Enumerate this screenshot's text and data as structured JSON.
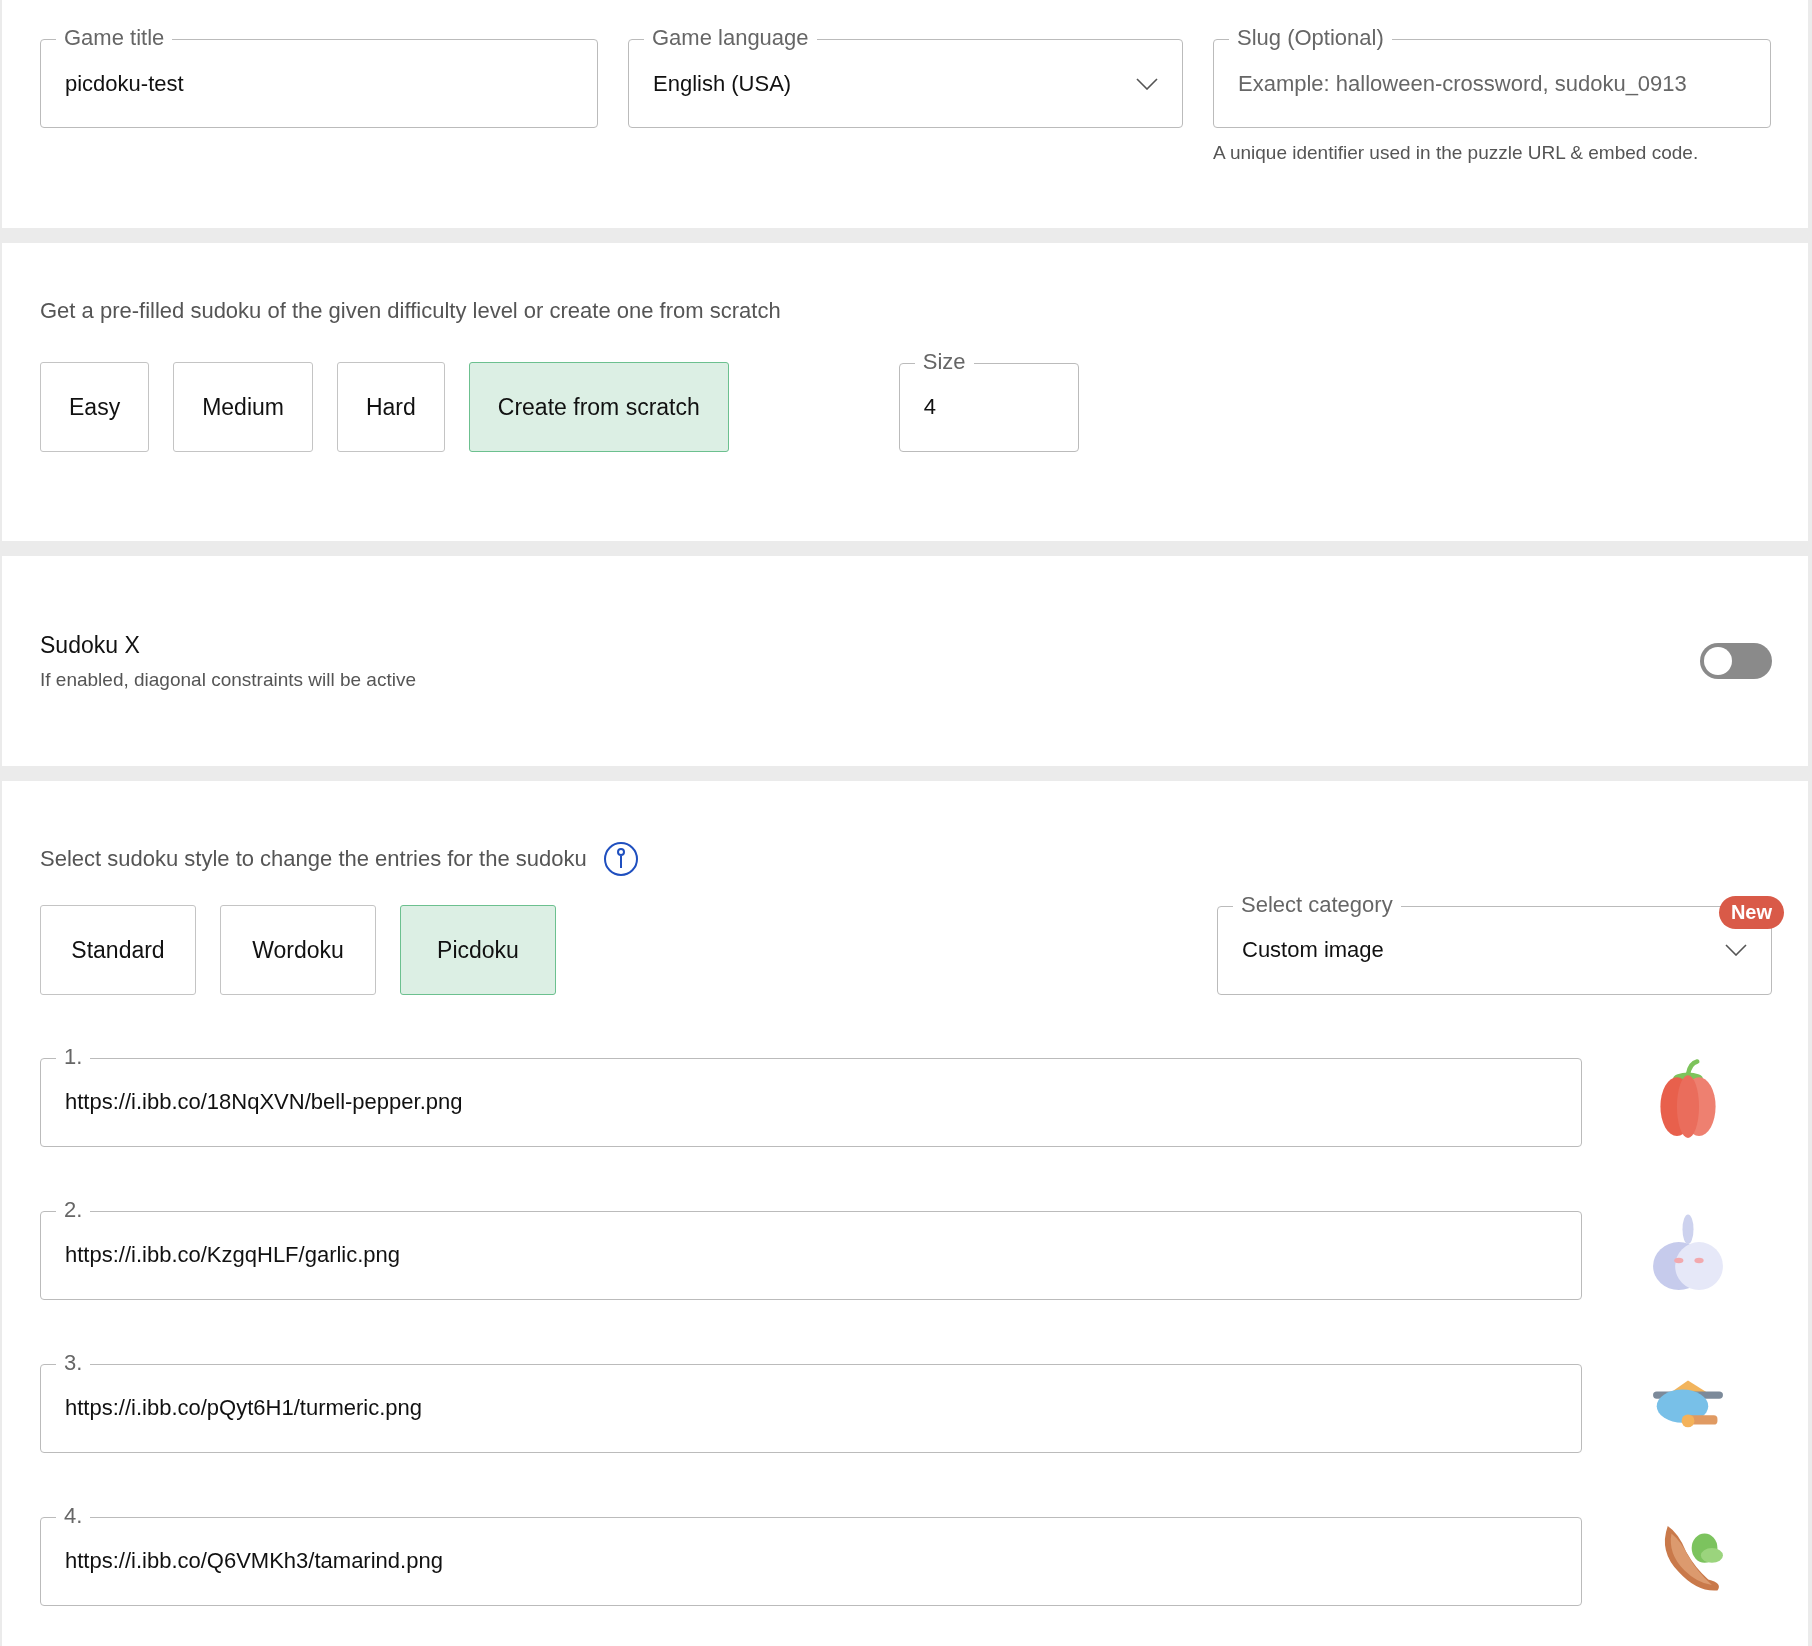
{
  "game_settings": {
    "game_title": {
      "label": "Game title",
      "value": "picdoku-test"
    },
    "game_language": {
      "label": "Game language",
      "value": "English (USA)"
    },
    "slug": {
      "label": "Slug (Optional)",
      "placeholder": "Example: halloween-crossword, sudoku_0913",
      "helper": "A unique identifier used in the puzzle URL & embed code."
    }
  },
  "difficulty": {
    "description": "Get a pre-filled sudoku of the given difficulty level or create one from scratch",
    "options": [
      {
        "label": "Easy",
        "selected": false
      },
      {
        "label": "Medium",
        "selected": false
      },
      {
        "label": "Hard",
        "selected": false
      },
      {
        "label": "Create from scratch",
        "selected": true
      }
    ],
    "size": {
      "label": "Size",
      "value": "4"
    }
  },
  "sudoku_x": {
    "title": "Sudoku X",
    "description": "If enabled, diagonal constraints will be active",
    "on": false
  },
  "style": {
    "description": "Select sudoku style to change the entries for the sudoku",
    "options": [
      {
        "label": "Standard",
        "selected": false
      },
      {
        "label": "Wordoku",
        "selected": false
      },
      {
        "label": "Picdoku",
        "selected": true
      }
    ],
    "category": {
      "label": "Select category",
      "value": "Custom image",
      "badge": "New"
    },
    "entries": [
      {
        "label": "1.",
        "url": "https://i.ibb.co/18NqXVN/bell-pepper.png"
      },
      {
        "label": "2.",
        "url": "https://i.ibb.co/KzgqHLF/garlic.png"
      },
      {
        "label": "3.",
        "url": "https://i.ibb.co/pQyt6H1/turmeric.png"
      },
      {
        "label": "4.",
        "url": "https://i.ibb.co/Q6VMKh3/tamarind.png"
      }
    ]
  }
}
